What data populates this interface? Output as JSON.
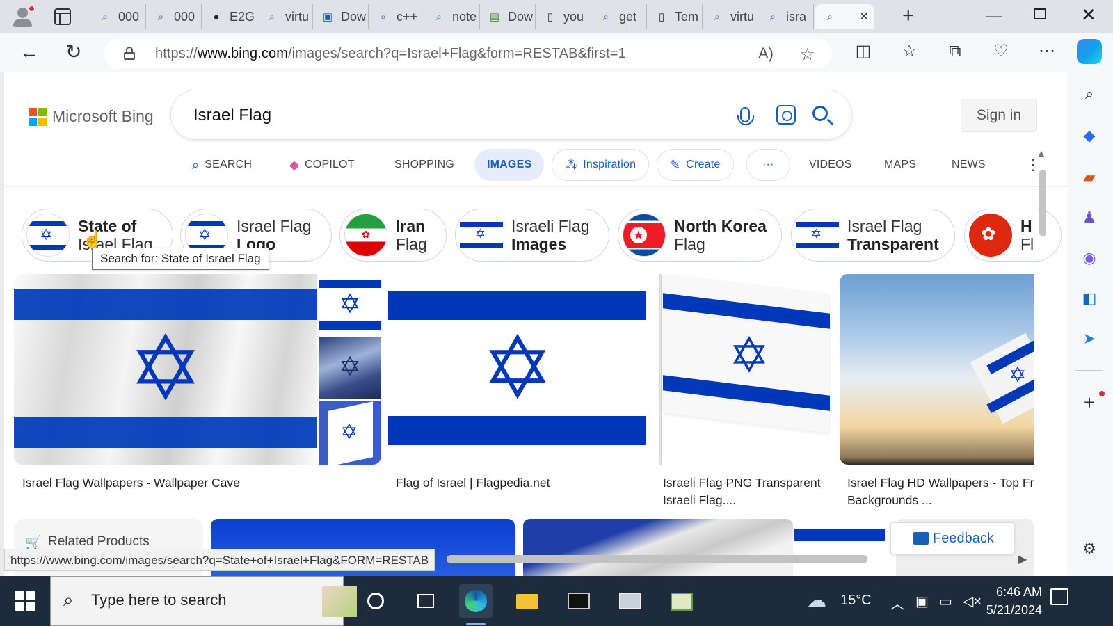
{
  "browser": {
    "tabs": [
      {
        "title": "000",
        "icon": "search-icon"
      },
      {
        "title": "000",
        "icon": "search-icon"
      },
      {
        "title": "E2G",
        "icon": "github-icon"
      },
      {
        "title": "virtu",
        "icon": "search-icon"
      },
      {
        "title": "Dow",
        "icon": "image-icon"
      },
      {
        "title": "c++",
        "icon": "search-icon"
      },
      {
        "title": "note",
        "icon": "search-icon"
      },
      {
        "title": "Dow",
        "icon": "chart-icon"
      },
      {
        "title": "you",
        "icon": "page-icon"
      },
      {
        "title": "get",
        "icon": "search-icon"
      },
      {
        "title": "Tem",
        "icon": "page-icon"
      },
      {
        "title": "virtu",
        "icon": "search-icon"
      },
      {
        "title": "isra",
        "icon": "search-icon"
      }
    ],
    "active_tab_close": "×",
    "new_tab": "+",
    "url_host_prefix": "https://",
    "url_host": "www.bing.com",
    "url_path": "/images/search?q=Israel+Flag&form=RESTAB&first=1"
  },
  "bing": {
    "logo_text": "Microsoft Bing",
    "logo_colors": [
      "#f25022",
      "#7fba00",
      "#00a4ef",
      "#ffb900"
    ],
    "query": "Israel Flag",
    "sign_in": "Sign in",
    "nav": {
      "search": "SEARCH",
      "copilot": "COPILOT",
      "shopping": "SHOPPING",
      "images": "IMAGES",
      "inspiration": "Inspiration",
      "create": "Create",
      "more": "···",
      "videos": "VIDEOS",
      "maps": "MAPS",
      "news": "NEWS"
    },
    "related_chips": [
      {
        "line1": "State of",
        "line2": "Israel Flag",
        "bold": "first"
      },
      {
        "line1": "Israel Flag",
        "line2": "Logo",
        "bold": "second"
      },
      {
        "line1": "Iran",
        "line2": "Flag",
        "bold": "first"
      },
      {
        "line1": "Israeli Flag",
        "line2": "Images",
        "bold": "second"
      },
      {
        "line1": "North Korea",
        "line2": "Flag",
        "bold": "first"
      },
      {
        "line1": "Israel Flag",
        "line2": "Transparent",
        "bold": "second"
      },
      {
        "line1": "H",
        "line2": "Fl",
        "bold": "first"
      }
    ],
    "tooltip": "Search for: State of Israel Flag",
    "results": [
      {
        "caption": "Israel Flag Wallpapers - Wallpaper Cave"
      },
      {
        "caption": "Flag of Israel | Flagpedia.net"
      },
      {
        "caption_line1": "Israeli Flag PNG Transparent",
        "caption_line2": "Israeli Flag...."
      },
      {
        "caption_line1": "Israel Flag HD Wallpapers - Top Fr",
        "caption_line2": "Backgrounds ..."
      }
    ],
    "related_products": "Related Products",
    "feedback": "Feedback",
    "status_url": "https://www.bing.com/images/search?q=State+of+Israel+Flag&FORM=RESTAB",
    "flag_blue": "#0038b8"
  },
  "taskbar": {
    "search_placeholder": "Type here to search",
    "temperature": "15°C",
    "time": "6:46 AM",
    "date": "5/21/2024"
  }
}
